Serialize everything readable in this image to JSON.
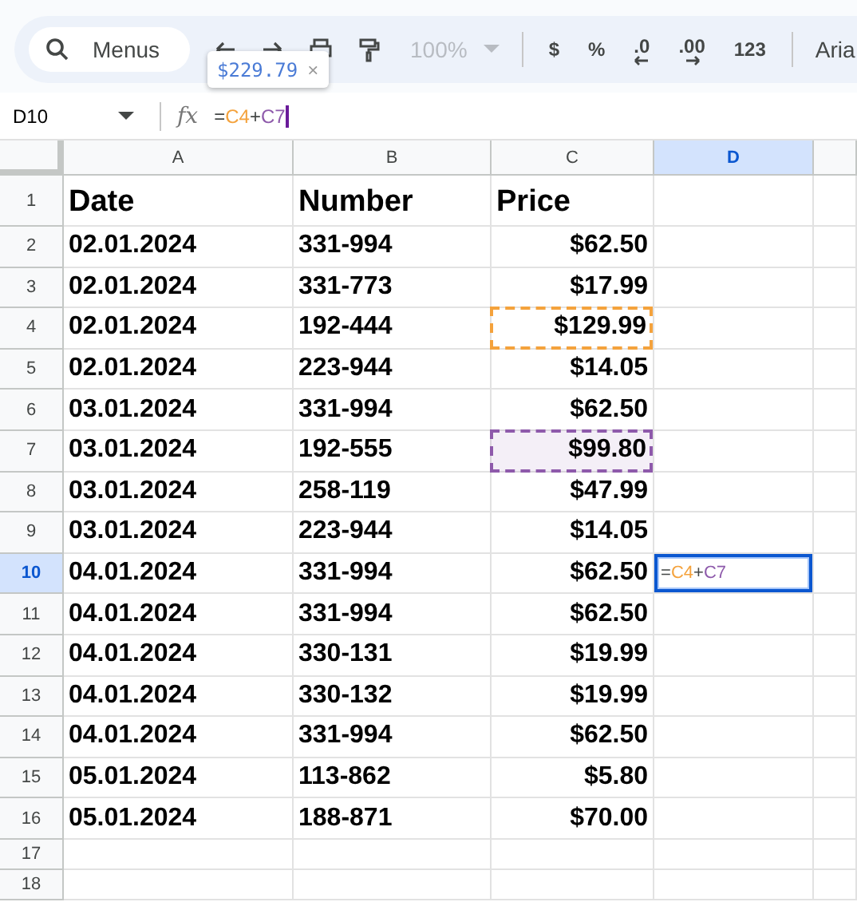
{
  "toolbar": {
    "search_label": "Menus",
    "zoom": "100%",
    "format_buttons": [
      {
        "text": "$",
        "kind": "plain"
      },
      {
        "text": "%",
        "kind": "plain"
      },
      {
        "text": ".0",
        "kind": "decrease"
      },
      {
        "text": ".00",
        "kind": "increase"
      },
      {
        "text": "123",
        "kind": "plain"
      }
    ],
    "font": "Aria"
  },
  "tooltip": {
    "value": "$229.79",
    "close": "×"
  },
  "formula_bar": {
    "name_box": "D10",
    "fx": "fx",
    "parts": [
      {
        "text": "=",
        "color": "#444746"
      },
      {
        "text": "C4",
        "color": "#f4a23c"
      },
      {
        "text": "+",
        "color": "#444746"
      },
      {
        "text": "C7",
        "color": "#8e5aab"
      }
    ]
  },
  "columns": [
    {
      "label": "A",
      "selected": false
    },
    {
      "label": "B",
      "selected": false
    },
    {
      "label": "C",
      "selected": false
    },
    {
      "label": "D",
      "selected": true
    },
    {
      "selected": false
    }
  ],
  "rows": [
    {
      "label": "1",
      "selected": false,
      "cells": [
        {
          "text": "Date",
          "kind": "heading"
        },
        {
          "text": "Number",
          "kind": "heading"
        },
        {
          "text": "Price",
          "kind": "heading"
        }
      ]
    },
    {
      "label": "2",
      "selected": false,
      "cells": [
        {
          "text": "02.01.2024"
        },
        {
          "text": "331-994"
        },
        {
          "text": "$62.50",
          "kind": "money"
        }
      ]
    },
    {
      "label": "3",
      "selected": false,
      "cells": [
        {
          "text": "02.01.2024"
        },
        {
          "text": "331-773"
        },
        {
          "text": "$17.99",
          "kind": "money"
        }
      ]
    },
    {
      "label": "4",
      "selected": false,
      "cells": [
        {
          "text": "02.01.2024"
        },
        {
          "text": "192-444"
        },
        {
          "text": "$129.99",
          "kind": "money",
          "color": "#f4a23c",
          "filled": false
        }
      ]
    },
    {
      "label": "5",
      "selected": false,
      "cells": [
        {
          "text": "02.01.2024"
        },
        {
          "text": "223-944"
        },
        {
          "text": "$14.05",
          "kind": "money"
        }
      ]
    },
    {
      "label": "6",
      "selected": false,
      "cells": [
        {
          "text": "03.01.2024"
        },
        {
          "text": "331-994"
        },
        {
          "text": "$62.50",
          "kind": "money"
        }
      ]
    },
    {
      "label": "7",
      "selected": false,
      "cells": [
        {
          "text": "03.01.2024"
        },
        {
          "text": "192-555"
        },
        {
          "text": "$99.80",
          "kind": "money",
          "color": "#8e5aab",
          "filled": true
        }
      ]
    },
    {
      "label": "8",
      "selected": false,
      "cells": [
        {
          "text": "03.01.2024"
        },
        {
          "text": "258-119"
        },
        {
          "text": "$47.99",
          "kind": "money"
        }
      ]
    },
    {
      "label": "9",
      "selected": false,
      "cells": [
        {
          "text": "03.01.2024"
        },
        {
          "text": "223-944"
        },
        {
          "text": "$14.05",
          "kind": "money"
        }
      ]
    },
    {
      "label": "10",
      "selected": true,
      "cells": [
        {
          "text": "04.01.2024"
        },
        {
          "text": "331-994"
        },
        {
          "text": "$62.50",
          "kind": "money"
        },
        {
          "kind": "editing",
          "parts": [
            {
              "text": "=",
              "color": "#444746"
            },
            {
              "text": "C4",
              "color": "#f4a23c"
            },
            {
              "text": "+",
              "color": "#444746"
            },
            {
              "text": "C7",
              "color": "#8e5aab"
            }
          ]
        }
      ]
    },
    {
      "label": "11",
      "selected": false,
      "cells": [
        {
          "text": "04.01.2024"
        },
        {
          "text": "331-994"
        },
        {
          "text": "$62.50",
          "kind": "money"
        }
      ]
    },
    {
      "label": "12",
      "selected": false,
      "cells": [
        {
          "text": "04.01.2024"
        },
        {
          "text": "330-131"
        },
        {
          "text": "$19.99",
          "kind": "money"
        }
      ]
    },
    {
      "label": "13",
      "selected": false,
      "cells": [
        {
          "text": "04.01.2024"
        },
        {
          "text": "330-132"
        },
        {
          "text": "$19.99",
          "kind": "money"
        }
      ]
    },
    {
      "label": "14",
      "selected": false,
      "cells": [
        {
          "text": "04.01.2024"
        },
        {
          "text": "331-994"
        },
        {
          "text": "$62.50",
          "kind": "money"
        }
      ]
    },
    {
      "label": "15",
      "selected": false,
      "cells": [
        {
          "text": "05.01.2024"
        },
        {
          "text": "113-862"
        },
        {
          "text": "$5.80",
          "kind": "money"
        }
      ]
    },
    {
      "label": "16",
      "selected": false,
      "cells": [
        {
          "text": "05.01.2024"
        },
        {
          "text": "188-871"
        },
        {
          "text": "$70.00",
          "kind": "money"
        }
      ]
    },
    {
      "label": "17",
      "selected": false,
      "cells": []
    },
    {
      "label": "18",
      "selected": false,
      "cells": []
    }
  ]
}
